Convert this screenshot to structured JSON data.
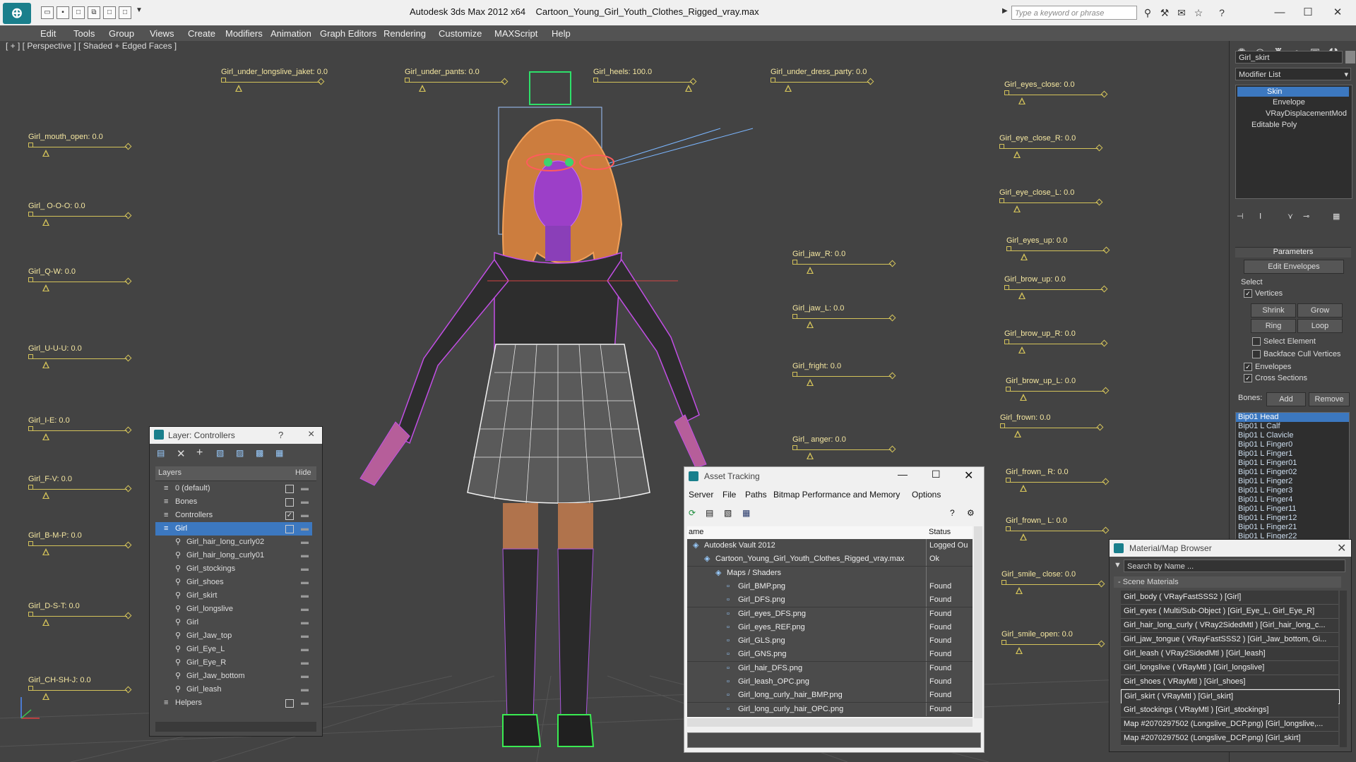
{
  "app": {
    "title": "Autodesk 3ds Max  2012 x64",
    "filename": "Cartoon_Young_Girl_Youth_Clothes_Rigged_vray.max",
    "search_placeholder": "Type a keyword or phrase"
  },
  "menu": [
    "Edit",
    "Tools",
    "Group",
    "Views",
    "Create",
    "Modifiers",
    "Animation",
    "Graph Editors",
    "Rendering",
    "Customize",
    "MAXScript",
    "Help"
  ],
  "viewport": {
    "label": "[ + ] [ Perspective ] [ Shaded + Edged Faces ]"
  },
  "controllers": [
    {
      "label": "Girl_under_longslive_jaket: 0.0"
    },
    {
      "label": "Girl_under_pants: 0.0"
    },
    {
      "label": "Girl_heels: 100.0"
    },
    {
      "label": "Girl_under_dress_party: 0.0"
    },
    {
      "label": "Girl_eyes_close: 0.0"
    },
    {
      "label": "Girl_mouth_open: 0.0"
    },
    {
      "label": "Girl_eye_close_R: 0.0"
    },
    {
      "label": "Girl_ O-O-O: 0.0"
    },
    {
      "label": "Girl_eye_close_L: 0.0"
    },
    {
      "label": "Girl_jaw_R: 0.0"
    },
    {
      "label": "Girl_eyes_up: 0.0"
    },
    {
      "label": "Girl_Q-W: 0.0"
    },
    {
      "label": "Girl_brow_up: 0.0"
    },
    {
      "label": "Girl_jaw_L: 0.0"
    },
    {
      "label": "Girl_brow_up_R: 0.0"
    },
    {
      "label": "Girl_U-U-U: 0.0"
    },
    {
      "label": "Girl_fright: 0.0"
    },
    {
      "label": "Girl_brow_up_L: 0.0"
    },
    {
      "label": "Girl_I-E: 0.0"
    },
    {
      "label": "Girl_frown: 0.0"
    },
    {
      "label": "Girl_ anger: 0.0"
    },
    {
      "label": "Girl_F-V: 0.0"
    },
    {
      "label": "Girl_frown_ R: 0.0"
    },
    {
      "label": "Girl_B-M-P: 0.0"
    },
    {
      "label": "Girl_frown_ L: 0.0"
    },
    {
      "label": "Girl_smile_ close: 0.0"
    },
    {
      "label": "Girl_D-S-T: 0.0"
    },
    {
      "label": "Girl_smile_open: 0.0"
    },
    {
      "label": "Girl_CH-SH-J: 0.0"
    }
  ],
  "command_panel": {
    "object_name": "Girl_skirt",
    "modifier_list_label": "Modifier List",
    "stack": [
      "Skin",
      "Envelope",
      "VRayDisplacementMod",
      "Editable Poly"
    ],
    "rollout_title": "Parameters",
    "edit_envelopes": "Edit Envelopes",
    "select_label": "Select",
    "vertices": "Vertices",
    "shrink": "Shrink",
    "grow": "Grow",
    "ring": "Ring",
    "loop": "Loop",
    "select_element": "Select Element",
    "backface": "Backface Cull Vertices",
    "envelopes": "Envelopes",
    "cross_sections": "Cross Sections",
    "bones_label": "Bones:",
    "add": "Add",
    "remove": "Remove",
    "bones": [
      "Bip01 Head",
      "Bip01 L Calf",
      "Bip01 L Clavicle",
      "Bip01 L Finger0",
      "Bip01 L Finger1",
      "Bip01 L Finger01",
      "Bip01 L Finger02",
      "Bip01 L Finger2",
      "Bip01 L Finger3",
      "Bip01 L Finger4",
      "Bip01 L Finger11",
      "Bip01 L Finger12",
      "Bip01 L Finger21",
      "Bip01 L Finger22"
    ]
  },
  "layer_panel": {
    "title": "Layer: Controllers",
    "help": "?",
    "close": "×",
    "col_layers": "Layers",
    "col_hide": "Hide",
    "rows": [
      {
        "label": "0 (default)"
      },
      {
        "label": "Bones"
      },
      {
        "label": "Controllers"
      },
      {
        "label": "Girl"
      },
      {
        "label": "Girl_hair_long_curly02"
      },
      {
        "label": "Girl_hair_long_curly01"
      },
      {
        "label": "Girl_stockings"
      },
      {
        "label": "Girl_shoes"
      },
      {
        "label": "Girl_skirt"
      },
      {
        "label": "Girl_longslive"
      },
      {
        "label": "Girl"
      },
      {
        "label": "Girl_Jaw_top"
      },
      {
        "label": "Girl_Eye_L"
      },
      {
        "label": "Girl_Eye_R"
      },
      {
        "label": "Girl_Jaw_bottom"
      },
      {
        "label": "Girl_leash"
      },
      {
        "label": "Helpers"
      }
    ]
  },
  "asset_tracking": {
    "title": "Asset Tracking",
    "menu": [
      "Server",
      "File",
      "Paths",
      "Bitmap Performance and Memory",
      "Options"
    ],
    "col_name": "ame",
    "col_status": "Status",
    "rows": [
      {
        "name": "Autodesk Vault 2012",
        "status": "Logged Ou"
      },
      {
        "name": "Cartoon_Young_Girl_Youth_Clothes_Rigged_vray.max",
        "status": "Ok"
      },
      {
        "name": "Maps / Shaders",
        "status": ""
      },
      {
        "name": "Girl_BMP.png",
        "status": "Found"
      },
      {
        "name": "Girl_DFS.png",
        "status": "Found"
      },
      {
        "name": "Girl_eyes_DFS.png",
        "status": "Found"
      },
      {
        "name": "Girl_eyes_REF.png",
        "status": "Found"
      },
      {
        "name": "Girl_GLS.png",
        "status": "Found"
      },
      {
        "name": "Girl_GNS.png",
        "status": "Found"
      },
      {
        "name": "Girl_hair_DFS.png",
        "status": "Found"
      },
      {
        "name": "Girl_leash_OPC.png",
        "status": "Found"
      },
      {
        "name": "Girl_long_curly_hair_BMP.png",
        "status": "Found"
      },
      {
        "name": "Girl_long_curly_hair_OPC.png",
        "status": "Found"
      }
    ]
  },
  "material_browser": {
    "title": "Material/Map Browser",
    "search_placeholder": "Search by Name ...",
    "section": "- Scene Materials",
    "rows": [
      "Girl_body  ( VRayFastSSS2 ) [Girl]",
      "Girl_eyes  ( Multi/Sub-Object ) [Girl_Eye_L, Girl_Eye_R]",
      "Girl_hair_long_curly  ( VRay2SidedMtl ) [Girl_hair_long_c...",
      "Girl_jaw_tongue  ( VRayFastSSS2 ) [Girl_Jaw_bottom, Gi...",
      "Girl_leash  ( VRay2SidedMtl ) [Girl_leash]",
      "Girl_longslive  ( VRayMtl ) [Girl_longslive]",
      "Girl_shoes  ( VRayMtl ) [Girl_shoes]",
      "Girl_skirt  ( VRayMtl ) [Girl_skirt]",
      "Girl_stockings  ( VRayMtl ) [Girl_stockings]",
      "Map #2070297502 (Longslive_DCP.png) [Girl_longslive,...",
      "Map #2070297502 (Longslive_DCP.png) [Girl_skirt]"
    ]
  }
}
